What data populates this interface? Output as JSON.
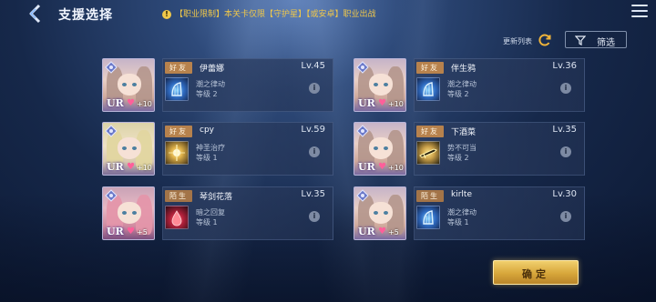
{
  "header": {
    "title": "支援选择",
    "notice_icon": "!",
    "notice_text": "【职业限制】本关卡仅限【守护星】【或安卓】职业出战"
  },
  "toolbar": {
    "refresh_label": "更新列表",
    "filter_label": "筛选"
  },
  "supports": [
    {
      "relation": "好友",
      "relation_type": "friend",
      "name": "伊蕾娜",
      "level": "Lv.45",
      "skill_name": "潮之律动",
      "skill_level": "等级 2",
      "rarity": "UR",
      "bond": "+10",
      "skill_icon": "harp-icon",
      "portrait_style": "silver-hair"
    },
    {
      "relation": "好友",
      "relation_type": "friend",
      "name": "伴生鸦",
      "level": "Lv.36",
      "skill_name": "潮之律动",
      "skill_level": "等级 2",
      "rarity": "UR",
      "bond": "+10",
      "skill_icon": "harp-icon",
      "portrait_style": "silver-hair"
    },
    {
      "relation": "好友",
      "relation_type": "friend",
      "name": "cpy",
      "level": "Lv.59",
      "skill_name": "神圣治疗",
      "skill_level": "等级 1",
      "rarity": "UR",
      "bond": "+10",
      "skill_icon": "holy-light-icon",
      "portrait_style": "blonde-hair"
    },
    {
      "relation": "好友",
      "relation_type": "friend",
      "name": "下酒菜",
      "level": "Lv.35",
      "skill_name": "势不可当",
      "skill_level": "等级 2",
      "rarity": "UR",
      "bond": "+10",
      "skill_icon": "sword-icon",
      "portrait_style": "silver-hair"
    },
    {
      "relation": "陌生",
      "relation_type": "stranger",
      "name": "琴剑花落",
      "level": "Lv.35",
      "skill_name": "暗之回复",
      "skill_level": "等级 1",
      "rarity": "UR",
      "bond": "+5",
      "skill_icon": "blood-drop-icon",
      "portrait_style": "pink-hair"
    },
    {
      "relation": "陌生",
      "relation_type": "stranger",
      "name": "kirlte",
      "level": "Lv.30",
      "skill_name": "潮之律动",
      "skill_level": "等级 1",
      "rarity": "UR",
      "bond": "+5",
      "skill_icon": "harp-icon",
      "portrait_style": "silver-hair"
    }
  ],
  "confirm_label": "确定",
  "colors": {
    "accent_gold": "#d7a63a",
    "notice_yellow": "#f0c84a",
    "relation_tag": "#b7824d",
    "heart_pink": "#ff5f9a"
  }
}
